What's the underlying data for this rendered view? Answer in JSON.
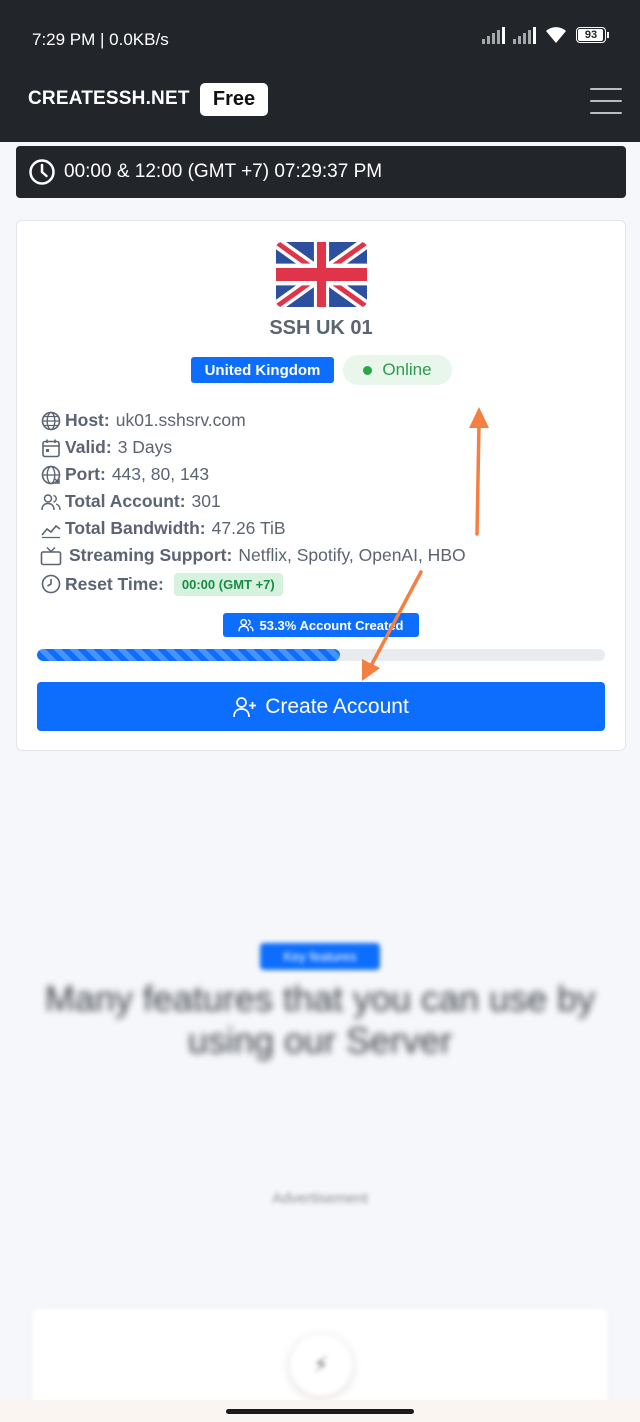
{
  "status_bar": {
    "time_speed": "7:29 PM | 0.0KB/s",
    "battery": "93"
  },
  "header": {
    "brand": "CREATESSH.NET",
    "badge": "Free"
  },
  "clock": {
    "text": "00:00 & 12:00 (GMT +7) 07:29:37 PM"
  },
  "server_card": {
    "title": "SSH UK 01",
    "country": "United Kingdom",
    "status": "Online",
    "info": [
      {
        "label": "Host:",
        "value": "uk01.sshsrv.com",
        "icon": "globe-icon"
      },
      {
        "label": "Valid:",
        "value": "3 Days",
        "icon": "calendar-icon"
      },
      {
        "label": "Port:",
        "value": "443, 80, 143",
        "icon": "network-globe-icon"
      },
      {
        "label": "Total Account:",
        "value": "301",
        "icon": "users-icon"
      },
      {
        "label": "Total Bandwidth:",
        "value": "47.26 TiB",
        "icon": "graph-icon"
      },
      {
        "label": "Streaming Support:",
        "value": "Netflix, Spotify, OpenAI, HBO",
        "icon": "tv-icon"
      },
      {
        "label": "Reset Time:",
        "value": "00:00 (GMT +7)",
        "icon": "clock-icon"
      }
    ],
    "created_label": "53.3% Account Created",
    "progress_fraction": 0.533,
    "create_button": "Create Account"
  },
  "features": {
    "badge": "Key features",
    "heading": "Many features that you can use by using our Server"
  },
  "advertisement": "Advertisement",
  "colors": {
    "primary": "#0d6efd",
    "dark": "#22252a",
    "success": "#28a745",
    "annotation": "#f47f41"
  }
}
